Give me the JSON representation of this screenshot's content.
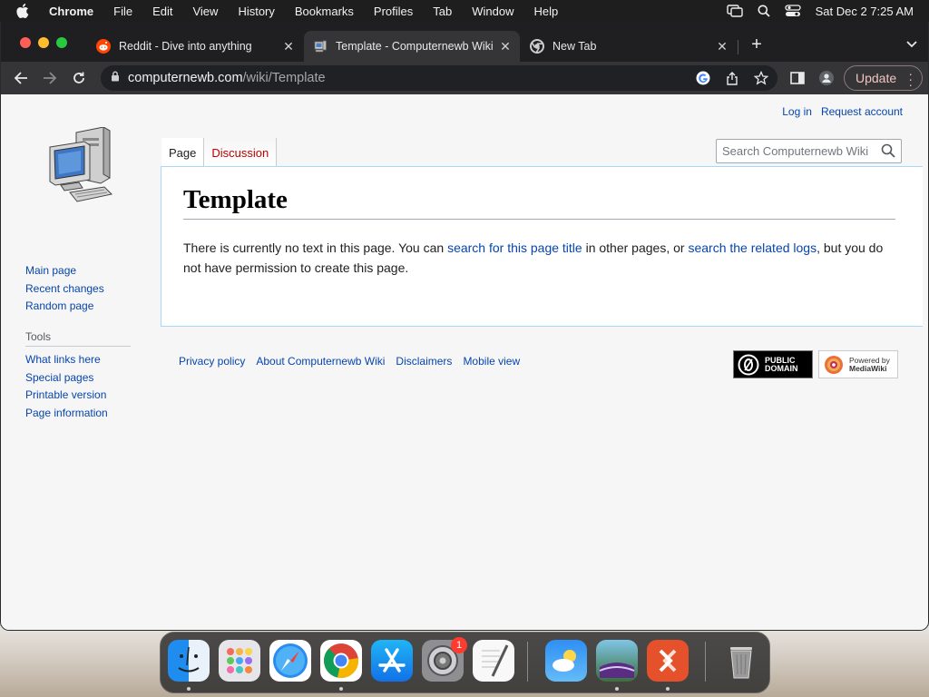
{
  "menubar": {
    "app": "Chrome",
    "items": [
      "File",
      "Edit",
      "View",
      "History",
      "Bookmarks",
      "Profiles",
      "Tab",
      "Window",
      "Help"
    ],
    "datetime": "Sat Dec 2  7:25 AM"
  },
  "browser": {
    "tabs": [
      {
        "title": "Reddit - Dive into anything",
        "active": false
      },
      {
        "title": "Template - Computernewb Wiki",
        "active": true
      },
      {
        "title": "New Tab",
        "active": false
      }
    ],
    "url_host": "computernewb.com",
    "url_path": "/wiki/Template",
    "update_label": "Update"
  },
  "wiki": {
    "personal": {
      "login": "Log in",
      "request": "Request account"
    },
    "nav": [
      "Main page",
      "Recent changes",
      "Random page"
    ],
    "tools_heading": "Tools",
    "tools": [
      "What links here",
      "Special pages",
      "Printable version",
      "Page information"
    ],
    "tabs": {
      "page": "Page",
      "discussion": "Discussion"
    },
    "search_placeholder": "Search Computernewb Wiki",
    "heading": "Template",
    "body": {
      "t1": "There is currently no text in this page. You can ",
      "link1": "search for this page title",
      "t2": " in other pages, or ",
      "link2": "search the related logs",
      "t3": ", but you do not have permission to create this page."
    },
    "footer": [
      "Privacy policy",
      "About Computernewb Wiki",
      "Disclaimers",
      "Mobile view"
    ],
    "badges": {
      "pd_line1": "PUBLIC",
      "pd_line2": "DOMAIN",
      "mw_line1": "Powered by",
      "mw_line2": "MediaWiki"
    }
  },
  "dock": {
    "apps": [
      "finder-icon",
      "launchpad-icon",
      "safari-icon",
      "chrome-icon",
      "app-store-icon",
      "system-settings-icon",
      "textedit-icon",
      "weather-icon",
      "image-app-icon",
      "remote-desktop-icon",
      "trash-icon"
    ],
    "settings_badge": "1"
  }
}
